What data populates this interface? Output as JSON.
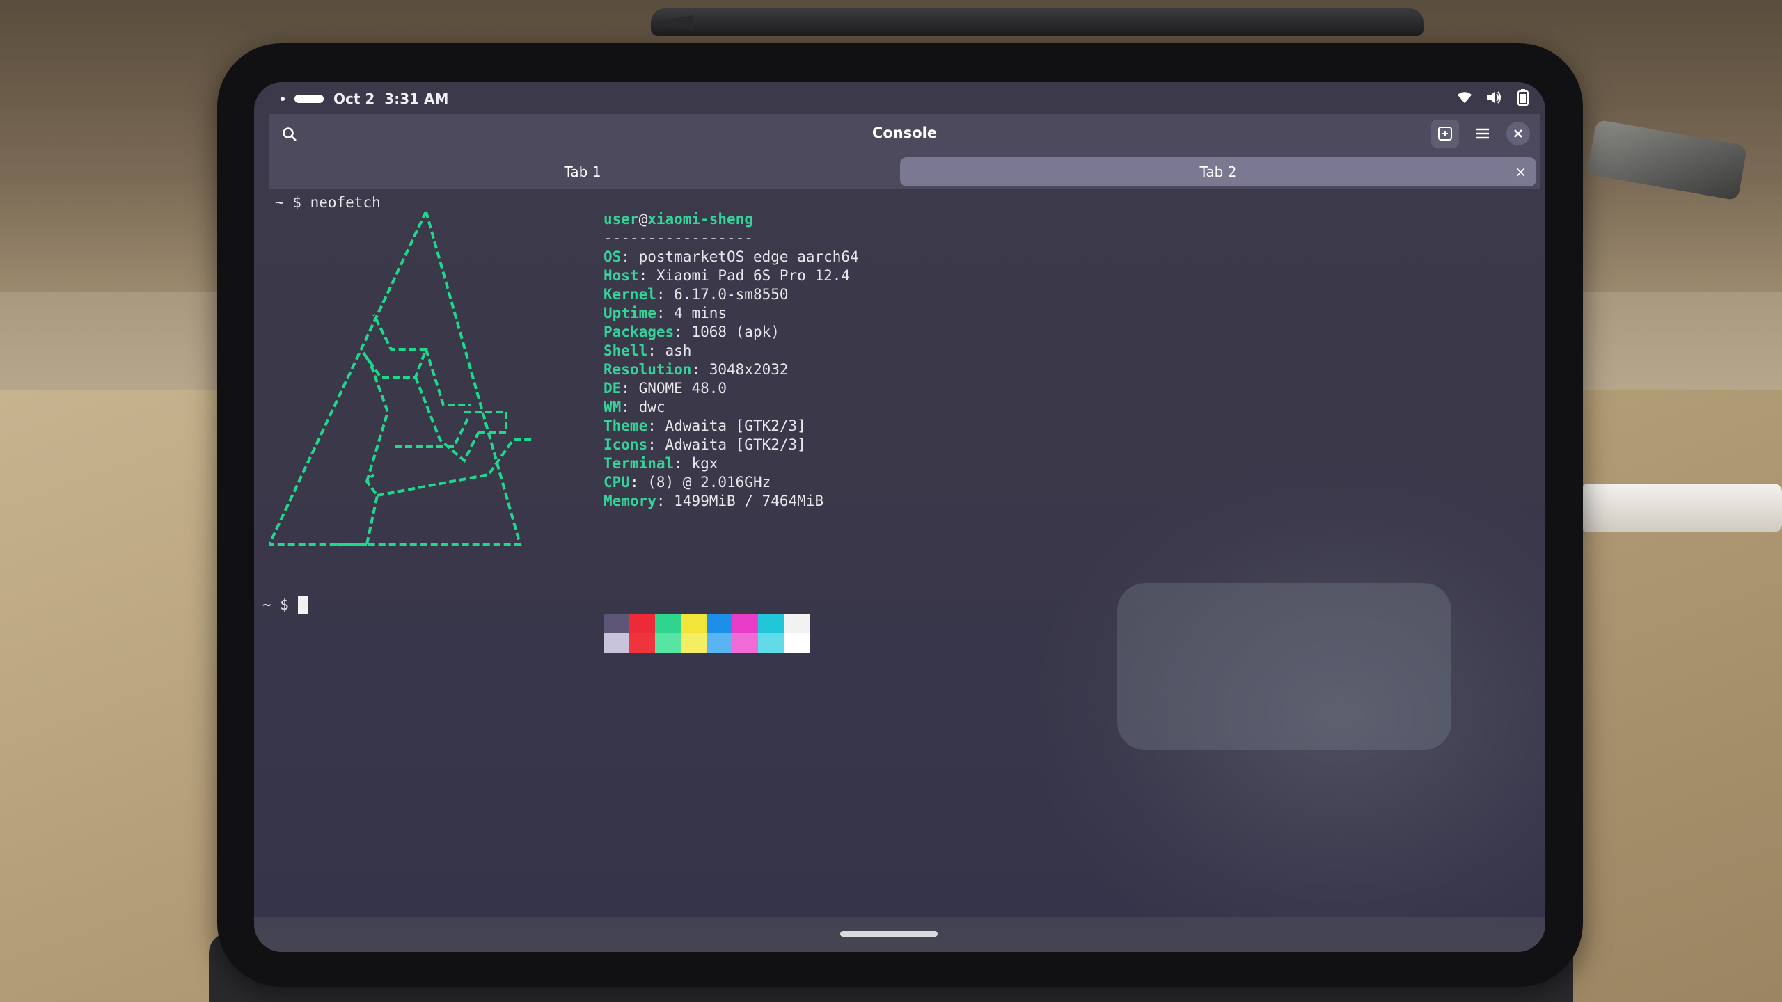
{
  "statusbar": {
    "date": "Oct 2",
    "time": "3:31 AM",
    "icons": [
      "wifi-icon",
      "volume-icon",
      "battery-icon"
    ]
  },
  "window": {
    "title": "Console"
  },
  "tabs": [
    {
      "label": "Tab 1",
      "active": false
    },
    {
      "label": "Tab 2",
      "active": true,
      "close_symbol": "×"
    }
  ],
  "terminal": {
    "prompt_symbol": "~ $",
    "command": "neofetch",
    "user": "user",
    "at": "@",
    "host": "xiaomi-sheng",
    "separator": "-----------------",
    "info": [
      {
        "key": "OS",
        "value": "postmarketOS edge aarch64"
      },
      {
        "key": "Host",
        "value": "Xiaomi Pad 6S Pro 12.4"
      },
      {
        "key": "Kernel",
        "value": "6.17.0-sm8550"
      },
      {
        "key": "Uptime",
        "value": "4 mins"
      },
      {
        "key": "Packages",
        "value": "1068 (apk)"
      },
      {
        "key": "Shell",
        "value": "ash"
      },
      {
        "key": "Resolution",
        "value": "3048x2032"
      },
      {
        "key": "DE",
        "value": "GNOME 48.0"
      },
      {
        "key": "WM",
        "value": "dwc"
      },
      {
        "key": "Theme",
        "value": "Adwaita [GTK2/3]"
      },
      {
        "key": "Icons",
        "value": "Adwaita [GTK2/3]"
      },
      {
        "key": "Terminal",
        "value": "kgx"
      },
      {
        "key": "CPU",
        "value": "(8) @ 2.016GHz"
      },
      {
        "key": "Memory",
        "value": "1499MiB / 7464MiB"
      }
    ],
    "palette_top": [
      "#5d5677",
      "#ef2a38",
      "#2fd48f",
      "#f2e53a",
      "#1e8fe8",
      "#e93cc8",
      "#21c6d8",
      "#f2f2f2"
    ],
    "palette_bottom": [
      "#c8c4dc",
      "#f0343e",
      "#58e5a4",
      "#f6ee62",
      "#5ab4f2",
      "#f06ad8",
      "#62dbe8",
      "#ffffff"
    ],
    "logo_color": "#1fd98b"
  },
  "colors": {
    "header_bg": "#4c4a5c",
    "active_tab_bg": "#7b7992",
    "accent": "#34d399"
  }
}
